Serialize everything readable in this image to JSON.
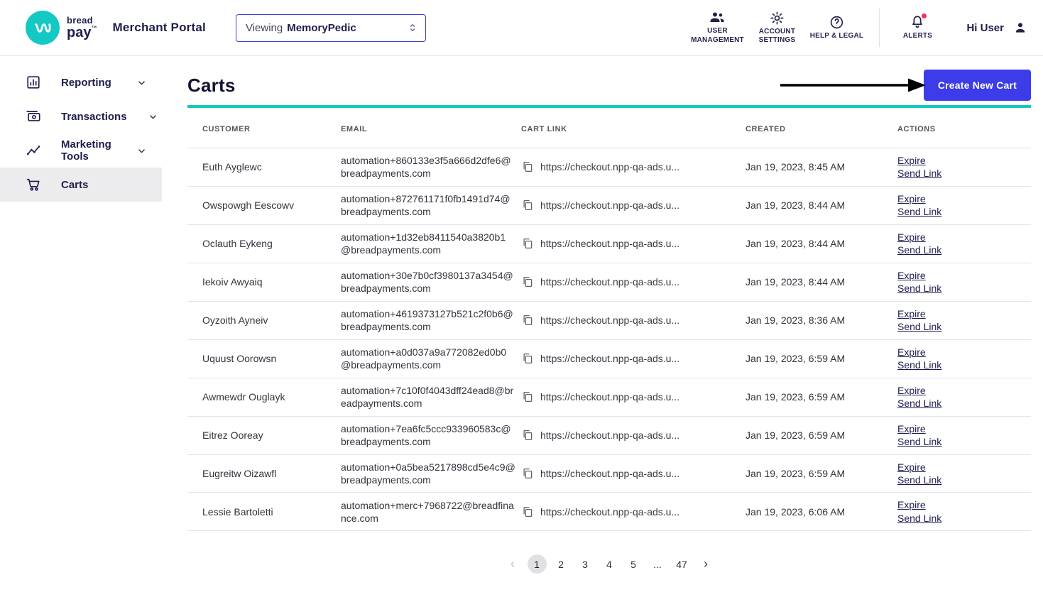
{
  "colors": {
    "primary": "#3C3CE8",
    "teal": "#14C8C4",
    "alert_dot": "#FF2D55",
    "action_link": "#1D1C52",
    "active_sidebar_bg": "#ECECEE"
  },
  "header": {
    "brand": {
      "name_top": "bread",
      "name_bottom": "pay",
      "trademark": "™",
      "portal": "Merchant Portal"
    },
    "viewing": {
      "prefix": "Viewing",
      "value": "MemoryPedic"
    },
    "nav": [
      {
        "icon": "people-icon",
        "label": "USER MANAGEMENT"
      },
      {
        "icon": "gear-icon",
        "label": "ACCOUNT SETTINGS"
      },
      {
        "icon": "help-icon",
        "label": "HELP & LEGAL"
      }
    ],
    "alerts_label": "ALERTS",
    "user_greeting": "Hi User"
  },
  "sidebar": {
    "items": [
      {
        "icon": "bar-chart-icon",
        "label": "Reporting",
        "expandable": true,
        "active": false
      },
      {
        "icon": "payments-icon",
        "label": "Transactions",
        "expandable": true,
        "active": false
      },
      {
        "icon": "insights-icon",
        "label": "Marketing Tools",
        "expandable": true,
        "active": false
      },
      {
        "icon": "cart-icon",
        "label": "Carts",
        "expandable": false,
        "active": true
      }
    ]
  },
  "main": {
    "title": "Carts",
    "create_button_label": "Create New Cart",
    "table": {
      "columns": [
        "CUSTOMER",
        "EMAIL",
        "CART LINK",
        "CREATED",
        "ACTIONS"
      ],
      "expire_label": "Expire",
      "send_label": "Send Link",
      "rows": [
        {
          "customer": "Euth Ayglewc",
          "email": "automation+860133e3f5a666d2dfe6@breadpayments.com",
          "link": "https://checkout.npp-qa-ads.u...",
          "created": "Jan 19, 2023, 8:45 AM"
        },
        {
          "customer": "Owspowgh Eescowv",
          "email": "automation+872761171f0fb1491d74@breadpayments.com",
          "link": "https://checkout.npp-qa-ads.u...",
          "created": "Jan 19, 2023, 8:44 AM"
        },
        {
          "customer": "Oclauth Eykeng",
          "email": "automation+1d32eb8411540a3820b1@breadpayments.com",
          "link": "https://checkout.npp-qa-ads.u...",
          "created": "Jan 19, 2023, 8:44 AM"
        },
        {
          "customer": "Iekoiv Awyaiq",
          "email": "automation+30e7b0cf3980137a3454@breadpayments.com",
          "link": "https://checkout.npp-qa-ads.u...",
          "created": "Jan 19, 2023, 8:44 AM"
        },
        {
          "customer": "Oyzoith Ayneiv",
          "email": "automation+4619373127b521c2f0b6@breadpayments.com",
          "link": "https://checkout.npp-qa-ads.u...",
          "created": "Jan 19, 2023, 8:36 AM"
        },
        {
          "customer": "Uquust Oorowsn",
          "email": "automation+a0d037a9a772082ed0b0@breadpayments.com",
          "link": "https://checkout.npp-qa-ads.u...",
          "created": "Jan 19, 2023, 6:59 AM"
        },
        {
          "customer": "Awmewdr Ouglayk",
          "email": "automation+7c10f0f4043dff24ead8@breadpayments.com",
          "link": "https://checkout.npp-qa-ads.u...",
          "created": "Jan 19, 2023, 6:59 AM"
        },
        {
          "customer": "Eitrez Ooreay",
          "email": "automation+7ea6fc5ccc933960583c@breadpayments.com",
          "link": "https://checkout.npp-qa-ads.u...",
          "created": "Jan 19, 2023, 6:59 AM"
        },
        {
          "customer": "Eugreitw Oizawfl",
          "email": "automation+0a5bea5217898cd5e4c9@breadpayments.com",
          "link": "https://checkout.npp-qa-ads.u...",
          "created": "Jan 19, 2023, 6:59 AM"
        },
        {
          "customer": "Lessie Bartoletti",
          "email": "automation+merc+7968722@breadfinance.com",
          "link": "https://checkout.npp-qa-ads.u...",
          "created": "Jan 19, 2023, 6:06 AM"
        }
      ]
    },
    "pagination": {
      "prev": "‹",
      "next": "›",
      "pages": [
        "1",
        "2",
        "3",
        "4",
        "5",
        "...",
        "47"
      ],
      "current": "1"
    }
  }
}
